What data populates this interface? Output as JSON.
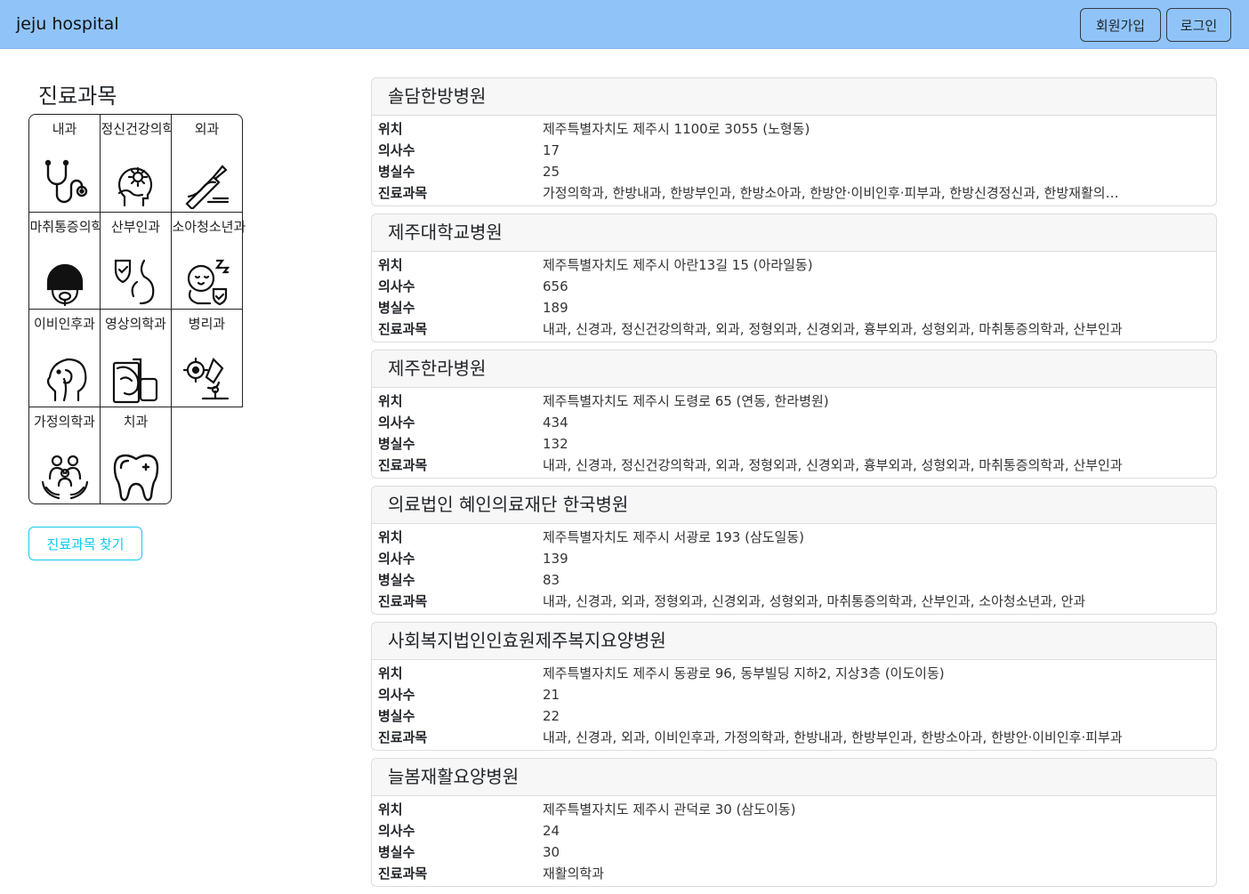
{
  "navbar": {
    "brand": "jeju hospital",
    "signup_label": "회원가입",
    "login_label": "로그인"
  },
  "sidebar": {
    "title": "진료과목",
    "departments": [
      {
        "label": "내과",
        "icon": "stethoscope-icon"
      },
      {
        "label": "정신건강의학과",
        "icon": "mental-health-icon"
      },
      {
        "label": "외과",
        "icon": "surgery-icon"
      },
      {
        "label": "마취통증의학과",
        "icon": "anesthesia-icon"
      },
      {
        "label": "산부인과",
        "icon": "pregnancy-icon"
      },
      {
        "label": "소아청소년과",
        "icon": "baby-icon"
      },
      {
        "label": "이비인후과",
        "icon": "ent-icon"
      },
      {
        "label": "영상의학과",
        "icon": "xray-icon"
      },
      {
        "label": "병리과",
        "icon": "microscope-icon"
      },
      {
        "label": "가정의학과",
        "icon": "family-icon"
      },
      {
        "label": "치과",
        "icon": "tooth-icon"
      }
    ],
    "find_button": "진료과목 찾기"
  },
  "field_labels": {
    "location": "위치",
    "doctors": "의사수",
    "rooms": "병실수",
    "departments": "진료과목"
  },
  "hospitals": [
    {
      "name": "솔담한방병원",
      "location": "제주특별자치도 제주시 1100로 3055 (노형동)",
      "doctors": "17",
      "rooms": "25",
      "departments": "가정의학과, 한방내과, 한방부인과, 한방소아과, 한방안·이비인후·피부과, 한방신경정신과, 한방재활의학과, 사상체질과"
    },
    {
      "name": "제주대학교병원",
      "location": "제주특별자치도 제주시 아란13길 15 (아라일동)",
      "doctors": "656",
      "rooms": "189",
      "departments": "내과, 신경과, 정신건강의학과, 외과, 정형외과, 신경외과, 흉부외과, 성형외과, 마취통증의학과, 산부인과"
    },
    {
      "name": "제주한라병원",
      "location": "제주특별자치도 제주시 도령로 65 (연동, 한라병원)",
      "doctors": "434",
      "rooms": "132",
      "departments": "내과, 신경과, 정신건강의학과, 외과, 정형외과, 신경외과, 흉부외과, 성형외과, 마취통증의학과, 산부인과"
    },
    {
      "name": "의료법인 혜인의료재단 한국병원",
      "location": "제주특별자치도 제주시 서광로 193 (삼도일동)",
      "doctors": "139",
      "rooms": "83",
      "departments": "내과, 신경과, 외과, 정형외과, 신경외과, 성형외과, 마취통증의학과, 산부인과, 소아청소년과, 안과"
    },
    {
      "name": "사회복지법인인효원제주복지요양병원",
      "location": "제주특별자치도 제주시 동광로 96, 동부빌딩 지하2, 지상3층 (이도이동)",
      "doctors": "21",
      "rooms": "22",
      "departments": "내과, 신경과, 외과, 이비인후과, 가정의학과, 한방내과, 한방부인과, 한방소아과, 한방안·이비인후·피부과"
    },
    {
      "name": "늘봄재활요양병원",
      "location": "제주특별자치도 제주시 관덕로 30 (삼도이동)",
      "doctors": "24",
      "rooms": "30",
      "departments": "재활의학과"
    }
  ]
}
